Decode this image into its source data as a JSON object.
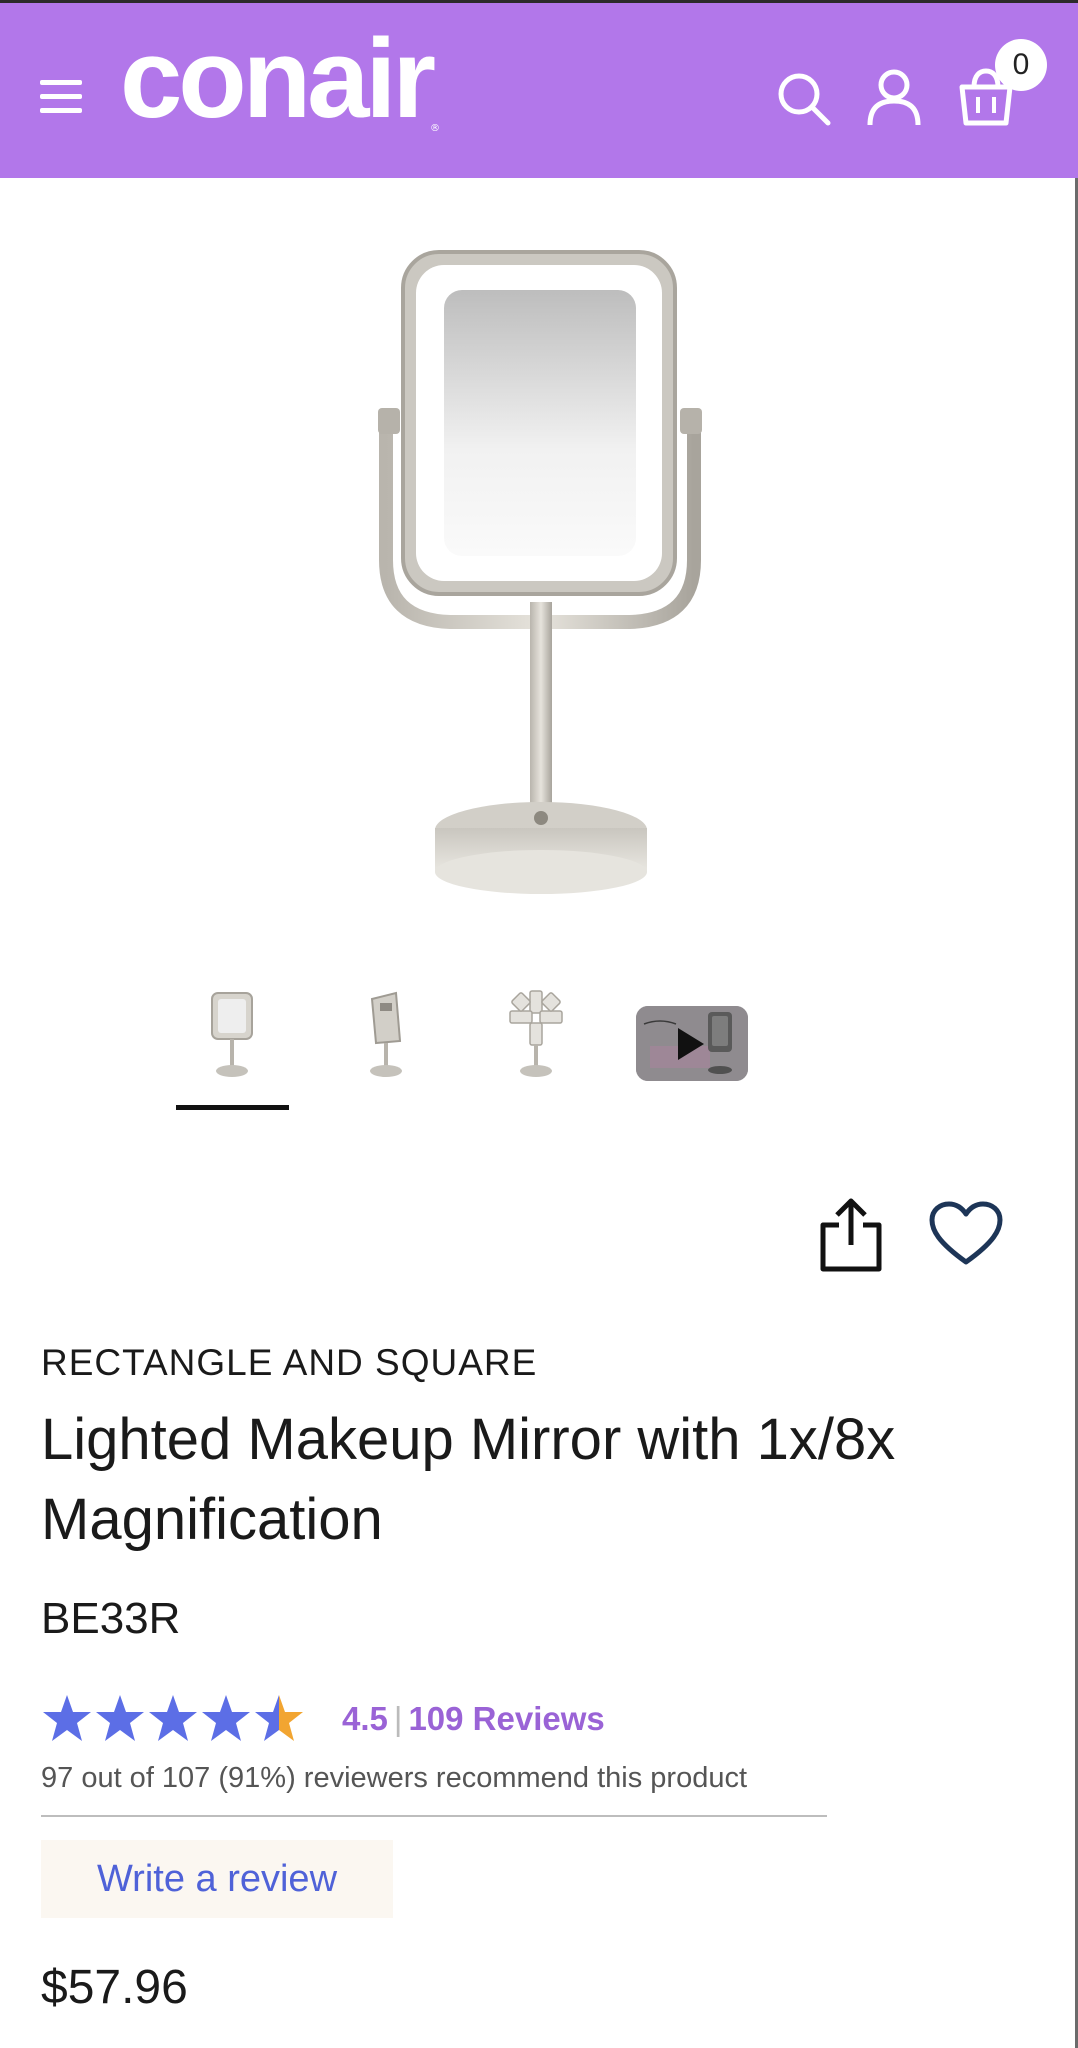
{
  "header": {
    "brand": "conair",
    "cart_count": "0",
    "bg_color": "#b277ea"
  },
  "icons": [
    "hamburger-menu-icon",
    "search-icon",
    "account-icon",
    "cart-icon",
    "share-icon",
    "heart-icon",
    "play-icon",
    "star-icon"
  ],
  "gallery": {
    "thumbnails": [
      "mirror-front",
      "mirror-side",
      "mirror-rotating",
      "video"
    ],
    "active_index": 0
  },
  "product": {
    "category": "RECTANGLE AND SQUARE",
    "title": "Lighted Makeup Mirror with 1x/8x Magnification",
    "sku": "BE33R",
    "rating": "4.5",
    "rating_fraction": 0.9,
    "separator": "|",
    "reviews_label": "109 Reviews",
    "recommend_text": "97 out of 107 (91%) reviewers recommend this product",
    "write_review_label": "Write a review",
    "price": "$57.96"
  },
  "colors": {
    "accent_purple": "#b277ea",
    "star_blue": "#5c6ee6",
    "star_half_orange": "#f2a531",
    "link_blue": "#4f62d8"
  }
}
